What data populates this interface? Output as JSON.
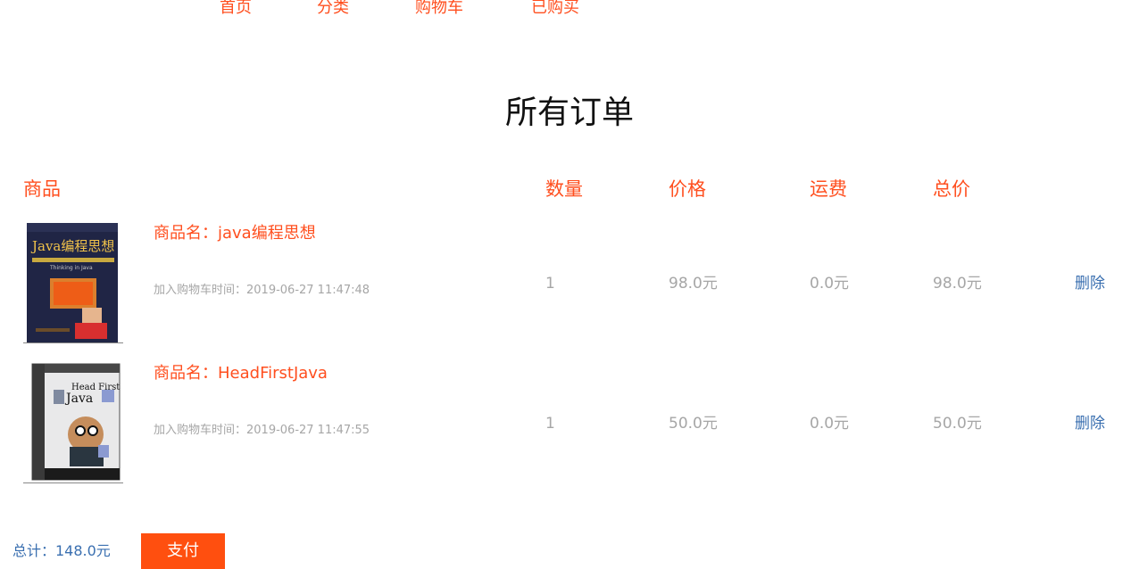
{
  "nav": {
    "items": [
      {
        "label": "首页"
      },
      {
        "label": "分类"
      },
      {
        "label": "购物车"
      },
      {
        "label": "已购买"
      }
    ]
  },
  "page": {
    "title": "所有订单"
  },
  "table": {
    "headers": {
      "product": "商品",
      "quantity": "数量",
      "price": "价格",
      "shipping": "运费",
      "total": "总价"
    },
    "rows": [
      {
        "cover_icon": "book-cover-java-programming-thought",
        "cover_title": "Java编程思想",
        "cover_subtitle": "Thinking in Java",
        "product_name": "商品名：java编程思想",
        "added_time": "加入购物车时间：2019-06-27 11:47:48",
        "quantity": "1",
        "price": "98.0元",
        "shipping": "0.0元",
        "total": "98.0元",
        "delete_label": "删除"
      },
      {
        "cover_icon": "book-cover-head-first-java",
        "cover_title": "Head First",
        "cover_subtitle": "Java",
        "product_name": "商品名：HeadFirstJava",
        "added_time": "加入购物车时间：2019-06-27 11:47:55",
        "quantity": "1",
        "price": "50.0元",
        "shipping": "0.0元",
        "total": "50.0元",
        "delete_label": "删除"
      }
    ]
  },
  "footer": {
    "total_label": "总计：148.0元",
    "pay_label": "支付"
  },
  "colors": {
    "accent": "#ff4f1f",
    "link": "#3a6fb0",
    "muted": "#a6a6a6",
    "button": "#ff4f0f"
  }
}
